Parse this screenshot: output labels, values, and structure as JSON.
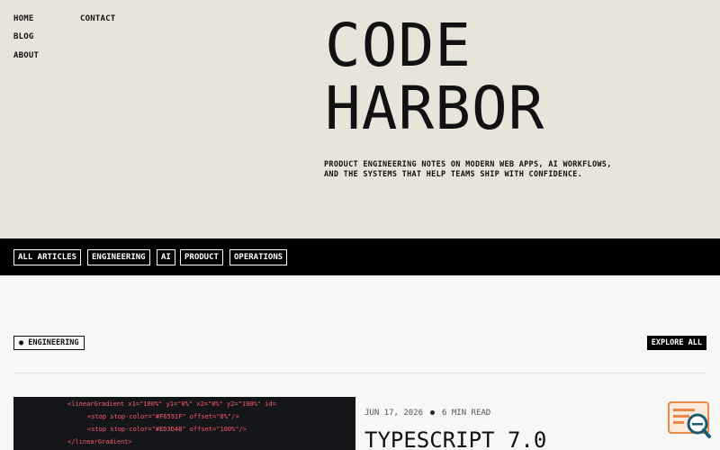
{
  "nav": {
    "home": "HOME",
    "blog": "BLOG",
    "about": "ABOUT",
    "contact": "CONTACT"
  },
  "brand": {
    "line1": "CODE",
    "line2": "HARBOR"
  },
  "tagline": "PRODUCT ENGINEERING NOTES ON MODERN WEB APPS, AI WORKFLOWS, AND THE SYSTEMS THAT HELP TEAMS SHIP WITH CONFIDENCE.",
  "categories": [
    "ALL ARTICLES",
    "ENGINEERING",
    "AI",
    "PRODUCT",
    "OPERATIONS"
  ],
  "section": {
    "tag": "ENGINEERING",
    "explore": "EXPLORE ALL"
  },
  "article": {
    "date": "JUN 17, 2026",
    "read_time": "6 MIN READ",
    "title": "TYPESCRIPT 7.0",
    "thumb_code": [
      "<linearGradient x1=\"100%\" y1=\"0%\" x2=\"0%\" y2=\"100%\" id=",
      "<stop stop-color=\"#F6591F\" offset=\"0%\"/>",
      "<stop stop-color=\"#ED3D4B\" offset=\"100%\"/>",
      "</linearGradient>"
    ]
  },
  "colors": {
    "hero_bg": "#e8e4d9",
    "bar_bg": "#000000",
    "accent": "#e8884a"
  },
  "icons": {
    "search_widget": "search-magnifier-icon"
  }
}
